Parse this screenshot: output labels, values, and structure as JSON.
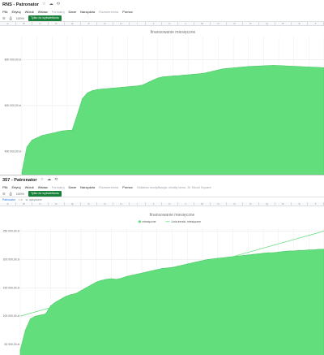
{
  "windows": [
    {
      "title": "RNS - Patronator",
      "menu": [
        {
          "label": "Plik",
          "dim": false
        },
        {
          "label": "Edytuj",
          "dim": false
        },
        {
          "label": "Widok",
          "dim": false
        },
        {
          "label": "Wstaw",
          "dim": false
        },
        {
          "label": "Formatuj",
          "dim": true
        },
        {
          "label": "Dane",
          "dim": false
        },
        {
          "label": "Narzędzia",
          "dim": false
        },
        {
          "label": "Rozszerzenia",
          "dim": true
        },
        {
          "label": "Pomoc",
          "dim": false
        }
      ],
      "toolbar": {
        "zoom": "100%",
        "chip": "Tylko do wyświetlania"
      },
      "columns": [
        "A",
        "B",
        "C",
        "D",
        "E",
        "F",
        "G",
        "H",
        "I",
        "J",
        "K",
        "L",
        "M",
        "N",
        "O",
        "P",
        "Q",
        "R",
        "S",
        "T"
      ]
    },
    {
      "title": "357 - Patronator",
      "menu": [
        {
          "label": "Plik",
          "dim": false
        },
        {
          "label": "Edytuj",
          "dim": false
        },
        {
          "label": "Widok",
          "dim": false
        },
        {
          "label": "Wstaw",
          "dim": false
        },
        {
          "label": "Formatuj",
          "dim": true
        },
        {
          "label": "Dane",
          "dim": false
        },
        {
          "label": "Narzędzia",
          "dim": false
        },
        {
          "label": "Rozszerzenia",
          "dim": true
        },
        {
          "label": "Pomoc",
          "dim": false
        },
        {
          "label": "Ostatnia modyfikacja: chwilę temu, M. Block Square",
          "dim": true
        }
      ],
      "toolbar": {
        "zoom": "100%",
        "chip": "Tylko do wyświetlania"
      },
      "filter": {
        "left": "Patronator",
        "mid": "r. a",
        "right": "w. opisywane"
      },
      "columns": [
        "A",
        "B",
        "C",
        "D",
        "E",
        "F",
        "G",
        "H",
        "I",
        "J",
        "K",
        "L",
        "M",
        "N",
        "O",
        "P",
        "Q",
        "R",
        "S",
        "T"
      ]
    }
  ],
  "chart_data": [
    {
      "type": "area",
      "title": "finansowanie miesięczne",
      "ylim": [
        300000,
        900000
      ],
      "yticks": [
        {
          "value": 400000,
          "label": "400 000,00 zł"
        },
        {
          "value": 600000,
          "label": "600 000,00 zł"
        },
        {
          "value": 800000,
          "label": "800 000,00 zł"
        }
      ],
      "grid": true,
      "color": "#62de7c",
      "x": [
        0,
        1,
        2,
        3,
        4,
        5,
        6,
        7,
        8,
        9,
        10,
        11,
        12,
        13,
        14,
        15,
        16,
        17,
        18,
        19,
        20,
        21,
        22,
        23,
        24,
        25,
        26,
        27,
        28,
        29,
        30,
        31,
        32,
        33,
        34,
        35,
        36,
        37,
        38,
        39,
        40,
        41,
        42,
        43,
        44,
        45,
        46,
        47,
        48,
        49,
        50,
        51,
        52,
        53,
        54,
        55,
        56,
        57,
        58,
        59,
        60
      ],
      "values": [
        310000,
        420000,
        450000,
        460000,
        470000,
        475000,
        480000,
        485000,
        490000,
        492000,
        494000,
        560000,
        630000,
        655000,
        665000,
        670000,
        672000,
        674000,
        676000,
        678000,
        680000,
        682000,
        684000,
        686000,
        690000,
        700000,
        710000,
        720000,
        725000,
        727000,
        729000,
        730000,
        732000,
        734000,
        736000,
        738000,
        740000,
        745000,
        750000,
        755000,
        760000,
        762000,
        764000,
        766000,
        768000,
        770000,
        771000,
        772000,
        773000,
        774000,
        775000,
        774000,
        773000,
        772000,
        771000,
        770000,
        769000,
        768000,
        767000,
        766000,
        765000
      ]
    },
    {
      "type": "area",
      "title": "finansowanie miesięczne",
      "ylim": [
        30000,
        255000
      ],
      "yticks": [
        {
          "value": 50000,
          "label": "50 000,00 zł"
        },
        {
          "value": 100000,
          "label": "100 000,00 zł"
        },
        {
          "value": 150000,
          "label": "150 000,00 zł"
        },
        {
          "value": 200000,
          "label": "200 000,00 zł"
        },
        {
          "value": 250000,
          "label": "250 000,00 zł"
        }
      ],
      "grid": true,
      "legend": {
        "position": "top",
        "entries": [
          "miesięczne",
          "Linia trendu: miesięczne"
        ]
      },
      "color": "#62de7c",
      "trend": {
        "start": 100000,
        "end": 250000,
        "color": "#62de7c"
      },
      "x": [
        0,
        1,
        2,
        3,
        4,
        5,
        6,
        7,
        8,
        9,
        10,
        11,
        12,
        13,
        14,
        15,
        16,
        17,
        18,
        19,
        20,
        21,
        22,
        23,
        24,
        25,
        26,
        27,
        28,
        29,
        30,
        31,
        32,
        33,
        34,
        35,
        36,
        37,
        38,
        39,
        40,
        41,
        42,
        43,
        44,
        45,
        46,
        47,
        48,
        49,
        50,
        51,
        52,
        53,
        54,
        55,
        56,
        57,
        58,
        59,
        60
      ],
      "values": [
        40000,
        75000,
        95000,
        100000,
        102000,
        104000,
        118000,
        125000,
        130000,
        135000,
        138000,
        140000,
        145000,
        150000,
        155000,
        160000,
        163000,
        165000,
        166000,
        165000,
        167000,
        170000,
        172000,
        174000,
        176000,
        178000,
        180000,
        182000,
        184000,
        185000,
        186000,
        188000,
        190000,
        192000,
        194000,
        196000,
        198000,
        200000,
        201000,
        202000,
        203000,
        204000,
        205000,
        206000,
        207000,
        208000,
        209000,
        210000,
        211000,
        212000,
        212000,
        213000,
        214000,
        215000,
        215000,
        216000,
        216000,
        217000,
        217000,
        218000,
        218000
      ]
    }
  ]
}
